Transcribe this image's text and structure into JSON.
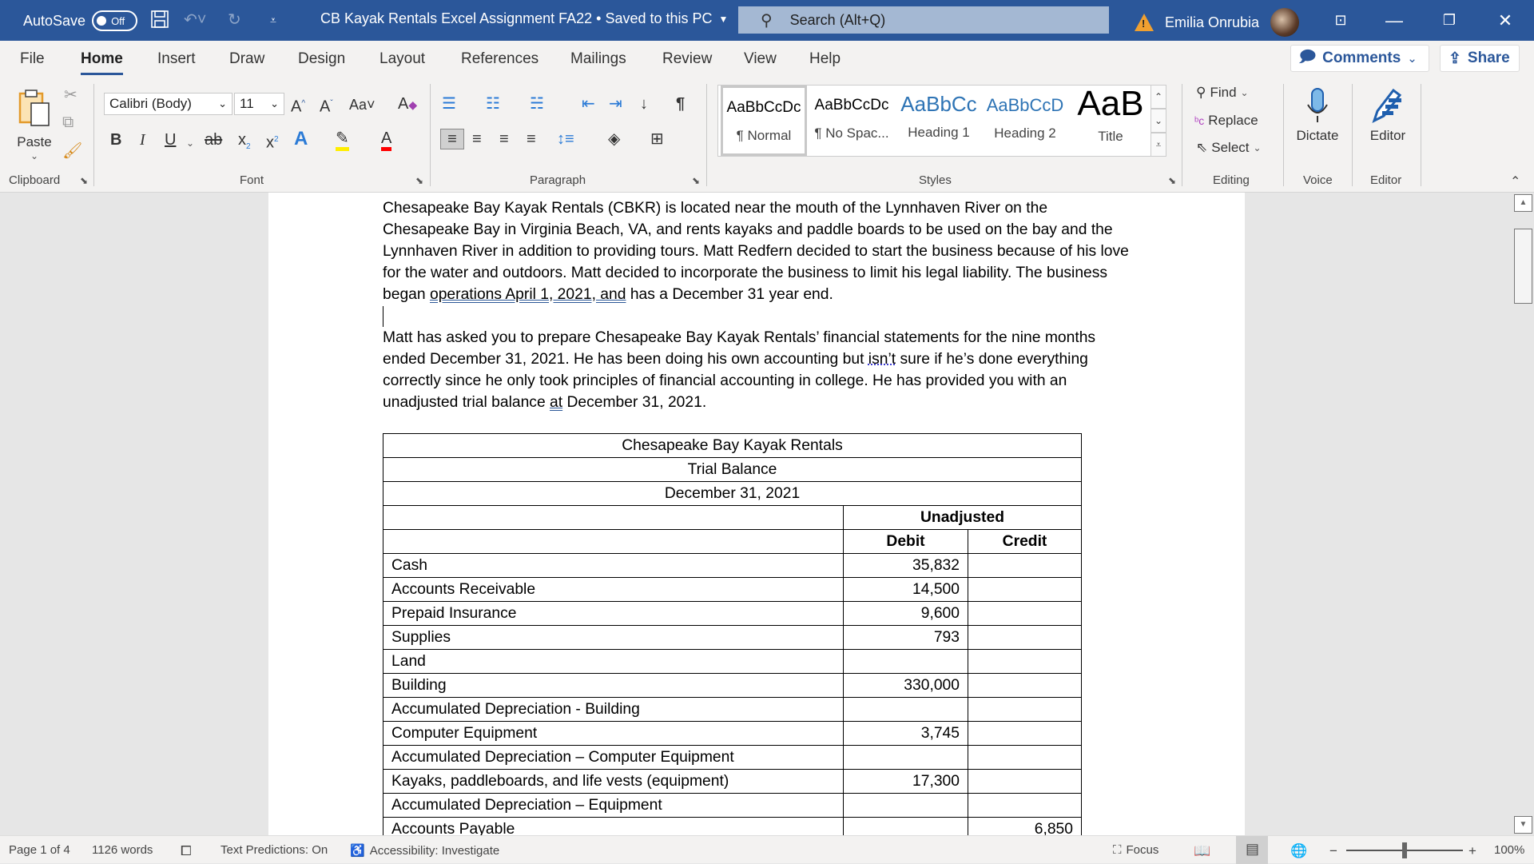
{
  "titlebar": {
    "autosave_label": "AutoSave",
    "autosave_state": "Off",
    "document_title": "CB Kayak Rentals Excel Assignment FA22 • Saved to this PC",
    "search_placeholder": "Search (Alt+Q)",
    "user_name": "Emilia Onrubia",
    "icons": [
      "save-icon",
      "undo-icon",
      "redo-icon",
      "customize-qat-icon",
      "warning-icon",
      "ribbon-display-icon",
      "minimize-icon",
      "restore-icon",
      "close-icon"
    ]
  },
  "tabs": [
    {
      "label": "File"
    },
    {
      "label": "Home",
      "active": true
    },
    {
      "label": "Insert"
    },
    {
      "label": "Draw"
    },
    {
      "label": "Design"
    },
    {
      "label": "Layout"
    },
    {
      "label": "References"
    },
    {
      "label": "Mailings"
    },
    {
      "label": "Review"
    },
    {
      "label": "View"
    },
    {
      "label": "Help"
    }
  ],
  "actions": {
    "comments": "Comments",
    "share": "Share"
  },
  "ribbon": {
    "clipboard": {
      "paste": "Paste",
      "label": "Clipboard"
    },
    "font": {
      "name": "Calibri (Body)",
      "size": "11",
      "label": "Font",
      "change_case": "Aa"
    },
    "paragraph": {
      "label": "Paragraph"
    },
    "styles": {
      "label": "Styles",
      "items": [
        {
          "preview": "AaBbCcDc",
          "name": "¶ Normal",
          "selected": true
        },
        {
          "preview": "AaBbCcDc",
          "name": "¶ No Spac..."
        },
        {
          "preview": "AaBbCc",
          "name": "Heading 1"
        },
        {
          "preview": "AaBbCcD",
          "name": "Heading 2"
        },
        {
          "preview": "AaB",
          "name": "Title"
        }
      ]
    },
    "editing": {
      "find": "Find",
      "replace": "Replace",
      "select": "Select",
      "label": "Editing"
    },
    "voice": {
      "dictate": "Dictate",
      "label": "Voice"
    },
    "editor": {
      "editor": "Editor",
      "label": "Editor"
    }
  },
  "document": {
    "para1_a": "Chesapeake Bay Kayak Rentals (CBKR) is located near the mouth of the Lynnhaven River on the Chesapeake Bay in Virginia Beach, VA, and rents kayaks and paddle boards to be used on the bay and the Lynnhaven River in addition to providing tours. Matt Redfern decided to start the business because of his love for the water and outdoors. Matt decided to incorporate the business to limit his legal liability. The business began ",
    "para1_ul": "operations April 1, 2021, and",
    "para1_b": " has a December 31 year end.",
    "para2_a": "Matt has asked you to prepare Chesapeake Bay Kayak Rentals’ financial statements for the nine months ended December 31, 2021. He has been doing his own accounting but ",
    "para2_dot": "isn’t",
    "para2_b": " sure if he’s done everything correctly since he only took principles of financial accounting in college.  He has provided you with an unadjusted trial balance ",
    "para2_ul": "at",
    "para2_c": " December 31, 2021.",
    "table": {
      "title": "Chesapeake Bay Kayak Rentals",
      "subtitle": "Trial Balance",
      "date": "December 31, 2021",
      "group_header": "Unadjusted",
      "columns": [
        "Debit",
        "Credit"
      ],
      "rows": [
        {
          "account": "Cash",
          "debit": "35,832",
          "credit": ""
        },
        {
          "account": "Accounts Receivable",
          "debit": "14,500",
          "credit": ""
        },
        {
          "account": "Prepaid Insurance",
          "debit": "9,600",
          "credit": ""
        },
        {
          "account": "Supplies",
          "debit": "793",
          "credit": ""
        },
        {
          "account": "Land",
          "debit": "",
          "credit": ""
        },
        {
          "account": "Building",
          "debit": "330,000",
          "credit": ""
        },
        {
          "account": "Accumulated Depreciation - Building",
          "debit": "",
          "credit": ""
        },
        {
          "account": "Computer Equipment",
          "debit": "3,745",
          "credit": ""
        },
        {
          "account": "Accumulated Depreciation – Computer Equipment",
          "debit": "",
          "credit": ""
        },
        {
          "account": "Kayaks, paddleboards, and life vests (equipment)",
          "debit": "17,300",
          "credit": ""
        },
        {
          "account": "Accumulated Depreciation – Equipment",
          "debit": "",
          "credit": ""
        },
        {
          "account": "Accounts Payable",
          "debit": "",
          "credit": "6,850"
        }
      ]
    }
  },
  "status": {
    "page": "Page 1 of 4",
    "words": "1126 words",
    "text_predictions": "Text Predictions: On",
    "accessibility": "Accessibility: Investigate",
    "focus": "Focus",
    "zoom": "100%",
    "zoom_minus": "−",
    "zoom_plus": "+"
  }
}
